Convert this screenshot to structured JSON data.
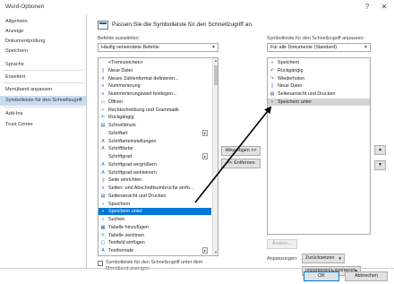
{
  "window": {
    "title": "Word-Optionen",
    "help_glyph": "?",
    "close_glyph": "✕"
  },
  "sidebar": {
    "items": [
      {
        "label": "Allgemein"
      },
      {
        "label": "Anzeige"
      },
      {
        "label": "Dokumentprüfung"
      },
      {
        "label": "Speichern"
      },
      {
        "label": "Sprache"
      },
      {
        "label": "Erweitert"
      },
      {
        "label": "Menüband anpassen"
      },
      {
        "label": "Symbolleiste für den Schnellzugriff"
      },
      {
        "label": "Add-Ins"
      },
      {
        "label": "Trust Center"
      }
    ],
    "active_index": 7
  },
  "header": {
    "text": "Passen Sie die Symbolleiste für den Schnellzugriff an."
  },
  "left": {
    "choose_label": "Befehle auswählen:",
    "choose_value": "Häufig verwendete Befehle",
    "commands": [
      {
        "label": "<Trennzeichen>",
        "icon": "separator-icon"
      },
      {
        "label": "Neue Datei",
        "icon": "new-file-icon"
      },
      {
        "label": "Neues Zahlenformat definieren...",
        "icon": "number-format-icon"
      },
      {
        "label": "Nummerierung",
        "icon": "numbering-icon"
      },
      {
        "label": "Nummerierungswert festlegen...",
        "icon": "numbering-value-icon"
      },
      {
        "label": "Öffnen",
        "icon": "open-folder-icon"
      },
      {
        "label": "Rechtschreibung und Grammatik",
        "icon": "spelling-icon"
      },
      {
        "label": "Rückgängig",
        "icon": "undo-icon"
      },
      {
        "label": "Schnelldruck",
        "icon": "quick-print-icon"
      },
      {
        "label": "Schriftart",
        "icon": "font-icon"
      },
      {
        "label": "Schriftarteinstellungen",
        "icon": "font-settings-icon"
      },
      {
        "label": "Schriftfarbe",
        "icon": "font-color-icon"
      },
      {
        "label": "Schriftgrad",
        "icon": "font-size-icon"
      },
      {
        "label": "Schriftgrad vergrößern",
        "icon": "grow-font-icon"
      },
      {
        "label": "Schriftgrad verkleinern",
        "icon": "shrink-font-icon"
      },
      {
        "label": "Seite einrichten",
        "icon": "page-setup-icon"
      },
      {
        "label": "Seiten- und Abschnittsumbrüche einfü...",
        "icon": "breaks-icon"
      },
      {
        "label": "Seitenansicht und Drucken",
        "icon": "print-preview-icon"
      },
      {
        "label": "Speichern",
        "icon": "save-icon"
      },
      {
        "label": "Speichern unter",
        "icon": "save-as-icon"
      },
      {
        "label": "Suchen",
        "icon": "search-icon"
      },
      {
        "label": "Tabelle hinzufügen",
        "icon": "table-icon"
      },
      {
        "label": "Tabelle zeichnen",
        "icon": "draw-table-icon"
      },
      {
        "label": "Textfeld einfügen",
        "icon": "textbox-icon"
      },
      {
        "label": "Textformate",
        "icon": "styles-icon"
      }
    ],
    "selected_index": 19,
    "show_below_ribbon": "Symbolleiste für den Schnellzugriff unter dem Menüband anzeigen"
  },
  "middle": {
    "add_label": "Hinzufügen >>",
    "remove_label": "<< Entfernen"
  },
  "right": {
    "customize_label": "Symbolleiste für den Schnellzugriff anpassen:",
    "customize_value": "Für alle Dokumente (Standard)",
    "items": [
      {
        "label": "Speichern",
        "icon": "save-icon"
      },
      {
        "label": "Rückgängig",
        "icon": "undo-icon"
      },
      {
        "label": "Wiederholen",
        "icon": "redo-icon"
      },
      {
        "label": "Neue Datei",
        "icon": "new-file-icon"
      },
      {
        "label": "Seitenansicht und Drucken",
        "icon": "print-preview-icon"
      },
      {
        "label": "Speichern unter",
        "icon": "save-as-icon"
      }
    ],
    "selected_index": 5,
    "modify_label": "Ändern...",
    "customizations_label": "Anpassungen:",
    "reset_label": "Zurücksetzen",
    "import_export_label": "Importieren/Exportieren"
  },
  "reorder": {
    "up_glyph": "▲",
    "down_glyph": "▼"
  },
  "footer": {
    "ok_label": "OK",
    "cancel_label": "Abbrechen"
  },
  "colors": {
    "selection": "#0078d7",
    "nav_active": "#c9ddf2",
    "arrow": "#000000"
  }
}
